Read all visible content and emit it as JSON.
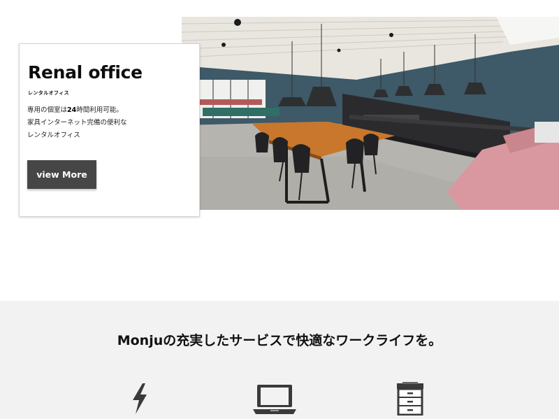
{
  "hero": {
    "title": "Renal office",
    "subtitle": "レンタルオフィス",
    "description": {
      "line1_prefix": "専用の個室は",
      "line1_number": "24",
      "line1_suffix": "時間利用可能。",
      "line2": "家具インターネット完備の便利な",
      "line3": "レンタルオフィス"
    },
    "button_label": "view More",
    "photo_icon": "office-kitchen-photo"
  },
  "services": {
    "heading_brand": "Monju",
    "heading_rest": "の充実したサービスで快適なワークライフを。",
    "icons": [
      "lightning-icon",
      "laptop-icon",
      "copier-icon"
    ]
  },
  "colors": {
    "button_bg": "#464646",
    "band_bg": "#f2f2f2",
    "wall": "#3f5a68",
    "table": "#c8772c",
    "sofa": "#d99aa3"
  }
}
